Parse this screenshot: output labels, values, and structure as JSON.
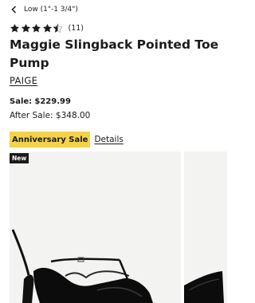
{
  "breadcrumb": {
    "label": "Low (1\"-1 3/4\")"
  },
  "rating": {
    "stars": 4.5,
    "count": "(11)"
  },
  "product": {
    "title": "Maggie Slingback Pointed Toe Pump",
    "brand": "PAIGE"
  },
  "pricing": {
    "sale_label": "Sale:",
    "sale_price": "$229.99",
    "after_sale": "After Sale: $348.00"
  },
  "promo": {
    "badge": "Anniversary Sale",
    "details_link": "Details",
    "badge_color": "#f3d34a"
  },
  "gallery": {
    "new_badge": "New",
    "main_image": "black-slingback-pump-photo",
    "next_image": "black-pump-toe-photo"
  }
}
